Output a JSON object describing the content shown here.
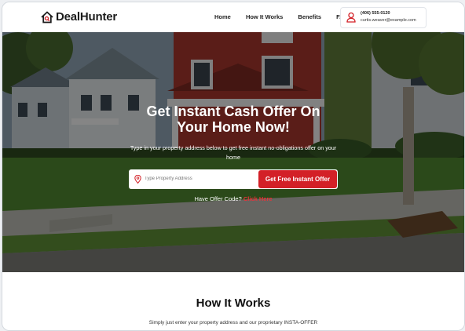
{
  "brand": {
    "name": "DealHunter",
    "accent": "#d32027"
  },
  "nav": {
    "items": [
      "Home",
      "How It Works",
      "Benefits",
      "FAQ"
    ]
  },
  "contact": {
    "phone": "(406) 555-0120",
    "email": "curtis.weaver@example.com",
    "icon": "user-pin-icon"
  },
  "hero": {
    "title_line1": "Get Instant Cash Offer On",
    "title_line2": "Your Home Now!",
    "subtitle": "Type in your property address below to get free instant no-obligations offer on your home",
    "search_placeholder": "Type Property Address",
    "cta_label": "Get Free Instant Offer",
    "offer_prompt": "Have Offer Code?",
    "offer_link": "Click Here"
  },
  "how_it_works": {
    "title": "How It Works",
    "body": "Simply just enter your property address and our proprietary INSTA-OFFER"
  }
}
